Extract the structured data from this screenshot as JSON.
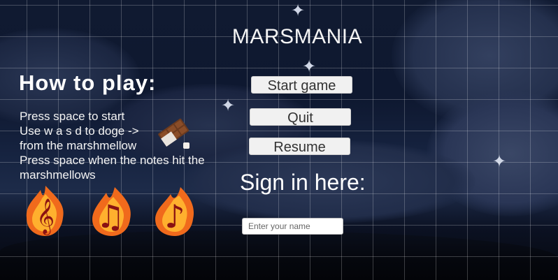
{
  "title": "MARSMANIA",
  "how_to_play": {
    "heading": "How to play:",
    "lines": [
      "Press space to start",
      "Use w a s d to doge ->",
      "from the marshmellow",
      "Press space when the notes hit the",
      "marshmellows"
    ]
  },
  "menu": {
    "start": "Start game",
    "quit": "Quit",
    "resume": "Resume"
  },
  "sign_in": {
    "heading": "Sign in here:",
    "placeholder": "Enter your name"
  },
  "icons": [
    "chocolate-marshmallow-icon",
    "fire-treble-clef-icon",
    "fire-eighth-note-icon",
    "fire-beamed-note-icon"
  ],
  "colors": {
    "sky": "#101a31",
    "text": "#f4f4f4",
    "button": "#f1f1f1"
  }
}
